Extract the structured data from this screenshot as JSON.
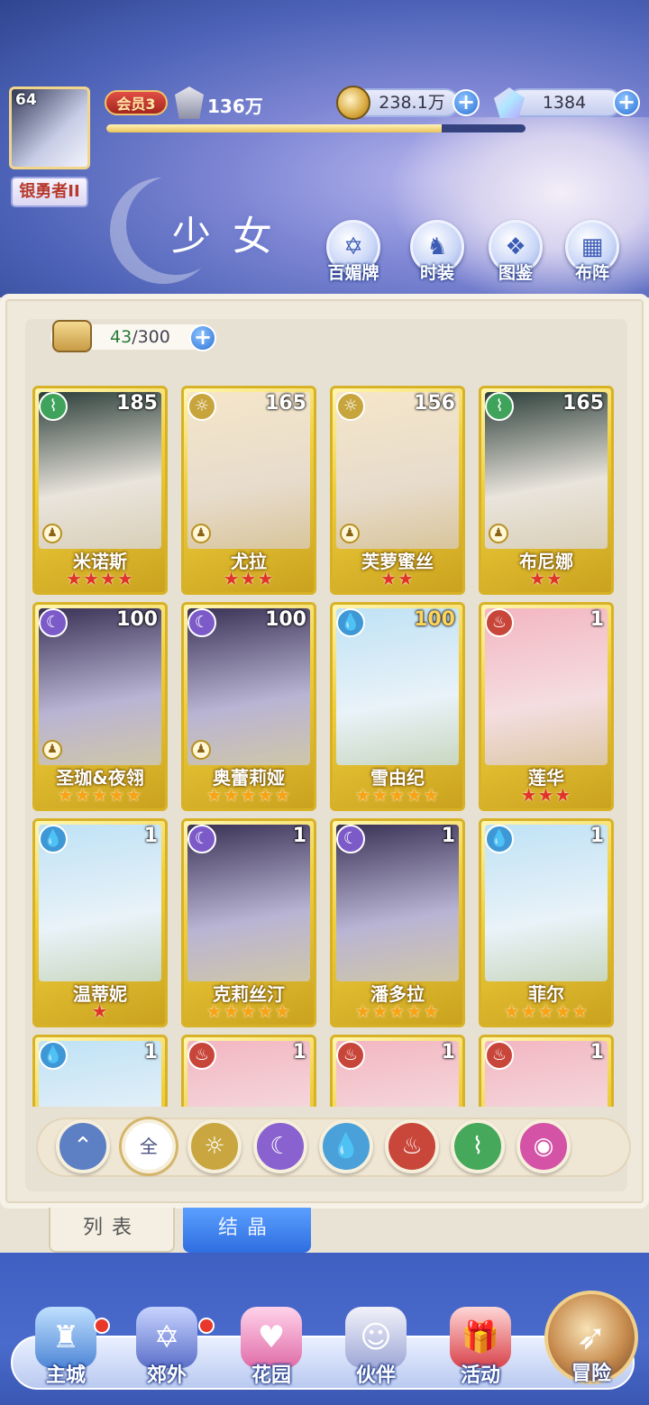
{
  "player": {
    "level": "64",
    "rank": "银勇者II",
    "vip": "会员3",
    "power": "136万",
    "exp_progress": 0.8
  },
  "currency": {
    "gold": "238.1万",
    "gems": "1384"
  },
  "header": {
    "title": "少女",
    "buttons": [
      "百媚牌",
      "时装",
      "图鉴",
      "布阵"
    ]
  },
  "roster": {
    "count": "43",
    "capacity": "/300"
  },
  "cards": [
    {
      "name": "米诺斯",
      "level": "185",
      "element": "wind",
      "stars": 4,
      "star_color": "red",
      "role": true
    },
    {
      "name": "尤拉",
      "level": "165",
      "element": "light",
      "stars": 3,
      "star_color": "red",
      "role": true
    },
    {
      "name": "芙萝蜜丝",
      "level": "156",
      "element": "light",
      "stars": 2,
      "star_color": "red",
      "role": true
    },
    {
      "name": "布尼娜",
      "level": "165",
      "element": "wind",
      "stars": 2,
      "star_color": "red",
      "role": true
    },
    {
      "name": "圣珈&夜翎",
      "level": "100",
      "element": "dark",
      "stars": 5,
      "star_color": "gold",
      "role": true
    },
    {
      "name": "奥蕾莉娅",
      "level": "100",
      "element": "dark",
      "stars": 5,
      "star_color": "gold",
      "role": true
    },
    {
      "name": "雪由纪",
      "level": "100",
      "element": "water",
      "stars": 5,
      "star_color": "gold",
      "role": false
    },
    {
      "name": "莲华",
      "level": "1",
      "element": "fire",
      "stars": 3,
      "star_color": "red",
      "role": false
    },
    {
      "name": "温蒂妮",
      "level": "1",
      "element": "water",
      "stars": 1,
      "star_color": "red",
      "role": false
    },
    {
      "name": "克莉丝汀",
      "level": "1",
      "element": "dark",
      "stars": 5,
      "star_color": "gold",
      "role": false
    },
    {
      "name": "潘多拉",
      "level": "1",
      "element": "dark",
      "stars": 5,
      "star_color": "gold",
      "role": false
    },
    {
      "name": "菲尔",
      "level": "1",
      "element": "water",
      "stars": 5,
      "star_color": "gold",
      "role": false
    },
    {
      "name": "",
      "level": "1",
      "element": "water",
      "stars": 0,
      "star_color": "gold",
      "role": false
    },
    {
      "name": "",
      "level": "1",
      "element": "fire",
      "stars": 0,
      "star_color": "gold",
      "role": false
    },
    {
      "name": "",
      "level": "1",
      "element": "fire",
      "stars": 0,
      "star_color": "gold",
      "role": false
    },
    {
      "name": "",
      "level": "1",
      "element": "fire",
      "stars": 0,
      "star_color": "gold",
      "role": false
    }
  ],
  "filters": [
    {
      "key": "wing",
      "label": "",
      "color": "#5d7fc4"
    },
    {
      "key": "all",
      "label": "全",
      "color": "#ffffff"
    },
    {
      "key": "light",
      "label": "",
      "color": "#c9a640"
    },
    {
      "key": "dark",
      "label": "",
      "color": "#8a62d0"
    },
    {
      "key": "water",
      "label": "",
      "color": "#4aa0d8"
    },
    {
      "key": "fire",
      "label": "",
      "color": "#c9473a"
    },
    {
      "key": "wind",
      "label": "",
      "color": "#45a85a"
    },
    {
      "key": "star",
      "label": "",
      "color": "#d453a6"
    }
  ],
  "tabs": {
    "list": "列表",
    "crystal": "结晶"
  },
  "nav": {
    "items": [
      "主城",
      "郊外",
      "花园",
      "伙伴",
      "活动"
    ],
    "adventure": "冒险"
  },
  "element_colors": {
    "wind": "#3fa35c",
    "light": "#c8a43d",
    "dark": "#7c5bc9",
    "water": "#3f98d6",
    "fire": "#c8453a"
  }
}
